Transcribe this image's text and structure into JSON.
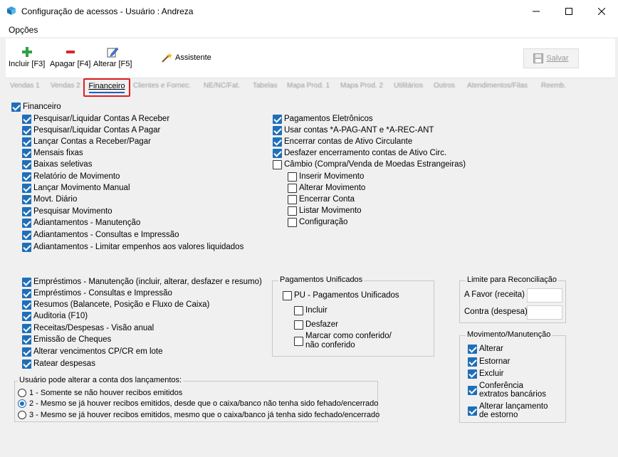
{
  "window": {
    "title": "Configuração de acessos - Usuário : Andreza"
  },
  "menu": {
    "opcoes": "Opções"
  },
  "toolbar": {
    "incluir": "Incluir [F3]",
    "apagar": "Apagar [F4]",
    "alterar": "Alterar [F5]",
    "assistente": "Assistente",
    "salvar": "Salvar"
  },
  "tabs": {
    "active": "Financeiro",
    "items": [
      "Vendas 1",
      "Vendas 2",
      "Clientes e Fornec.",
      "NE/NC/Fat.",
      "Tabelas",
      "Mapa Prod. 1",
      "Mapa Prod. 2",
      "Utilitários",
      "Outros",
      "Atendimentos/Filas",
      "Reemb."
    ]
  },
  "financeiro": {
    "root": "Financeiro",
    "left1": [
      "Pesquisar/Liquidar Contas A Receber",
      "Pesquisar/Liquidar Contas A Pagar",
      "Lançar Contas a Receber/Pagar",
      "Mensais fixas",
      "Baixas seletivas",
      "Relatório de Movimento",
      "Lançar Movimento Manual",
      "Movt. Diário",
      "Pesquisar Movimento",
      "Adiantamentos - Manutenção",
      "Adiantamentos - Consultas e Impressão",
      "Adiantamentos - Limitar empenhos aos valores liquidados"
    ],
    "right1": [
      "Pagamentos Eletrônicos",
      "Usar contas *A-PAG-ANT e *A-REC-ANT",
      "Encerrar contas de Ativo Circulante",
      "Desfazer encerramento contas de Ativo Circ.",
      "Câmbio (Compra/Venda de Moedas Estrangeiras)"
    ],
    "cambio_sub": [
      "Inserir Movimento",
      "Alterar Movimento",
      "Encerrar Conta",
      "Listar Movimento",
      "Configuração"
    ],
    "left2": [
      "Empréstimos - Manutenção (incluir, alterar, desfazer e resumo)",
      "Empréstimos - Consultas e Impressão",
      "Resumos (Balancete, Posição e Fluxo de Caixa)",
      "Auditoria (F10)",
      "Receitas/Despesas - Visão anual",
      "Emissão de Cheques",
      "Alterar vencimentos CP/CR em lote",
      "Ratear despesas"
    ]
  },
  "pagamentos_unificados": {
    "title": "Pagamentos Unificados",
    "pu": "PU - Pagamentos Unificados",
    "incluir": "Incluir",
    "desfazer": "Desfazer",
    "marcar": "Marcar como conferido/\nnão conferido"
  },
  "limite": {
    "title": "Limite para Reconciliação",
    "favor": "A Favor (receita)",
    "contra": "Contra (despesa)"
  },
  "movimento": {
    "title": "Movimento/Manutenção",
    "alterar": "Alterar",
    "estornar": "Estornar",
    "excluir": "Excluir",
    "conferencia": "Conferência\nextratos bancários",
    "alterar_lanc": "Alterar lançamento\nde estorno"
  },
  "usuario_conta": {
    "title": "Usuário pode alterar a conta dos lançamentos:",
    "opt1": "1 - Somente se não houver recibos emitidos",
    "opt2": "2 - Mesmo se já houver recibos emitidos, desde que o caixa/banco não tenha sido fehado/encerrado",
    "opt3": "3 - Mesmo se já houver recibos emitidos, mesmo que o caixa/banco já tenha sido fechado/encerrado"
  }
}
